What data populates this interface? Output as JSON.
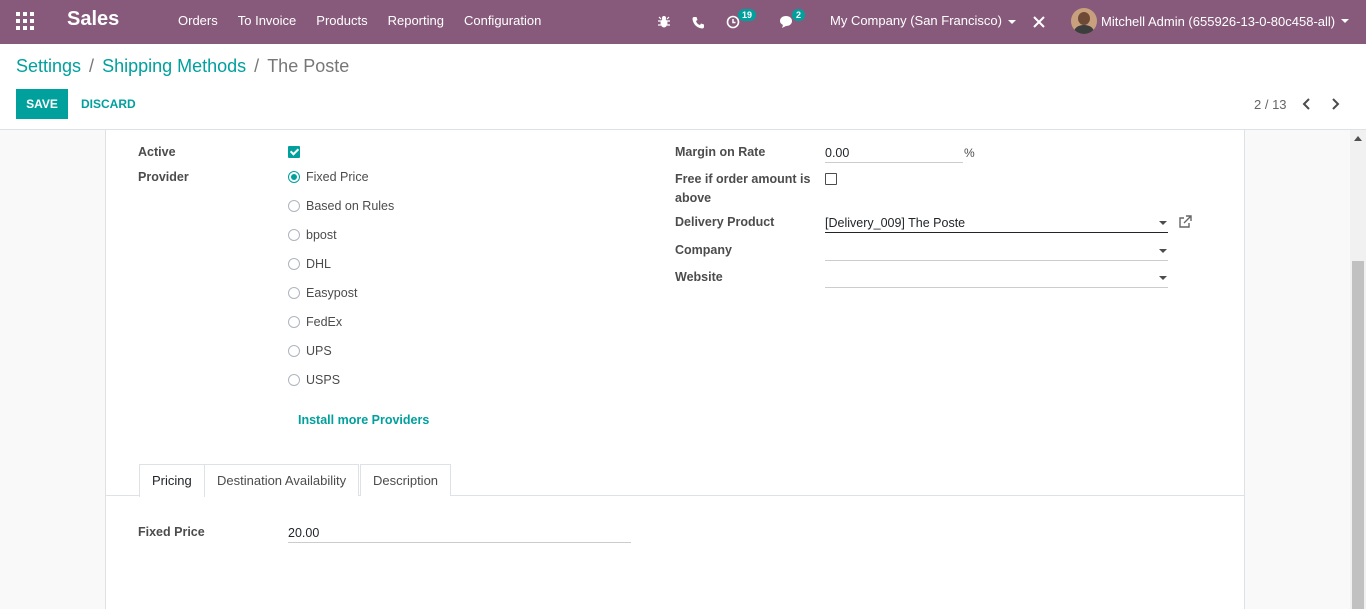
{
  "navbar": {
    "app_name": "Sales",
    "menu": [
      "Orders",
      "To Invoice",
      "Products",
      "Reporting",
      "Configuration"
    ],
    "activity_count": "19",
    "messages_count": "2",
    "company": "My Company (San Francisco)",
    "user": "Mitchell Admin (655926-13-0-80c458-all)",
    "icons": [
      "apps-grid-icon",
      "bug-icon",
      "phone-icon",
      "clock-icon",
      "chat-icon",
      "close-icon"
    ],
    "color": "#875a7b"
  },
  "breadcrumb": {
    "items": [
      "Settings",
      "Shipping Methods"
    ],
    "current": "The Poste",
    "separator": "/"
  },
  "buttons": {
    "save": "SAVE",
    "discard": "DISCARD"
  },
  "pager": {
    "text": "2 / 13"
  },
  "form": {
    "active_label": "Active",
    "active": true,
    "provider_label": "Provider",
    "providers": [
      "Fixed Price",
      "Based on Rules",
      "bpost",
      "DHL",
      "Easypost",
      "FedEx",
      "UPS",
      "USPS"
    ],
    "selected_provider": "Fixed Price",
    "install_more": "Install more Providers",
    "margin_label": "Margin on Rate",
    "margin_value": "0.00",
    "margin_unit": "%",
    "free_label_1": "Free if order amount is",
    "free_label_2": "above",
    "free_checked": false,
    "delivery_product_label": "Delivery Product",
    "delivery_product_value": "[Delivery_009] The Poste",
    "company_label": "Company",
    "company_value": "",
    "website_label": "Website",
    "website_value": ""
  },
  "tabs": [
    "Pricing",
    "Destination Availability",
    "Description"
  ],
  "active_tab": "Pricing",
  "pricing": {
    "fixed_price_label": "Fixed Price",
    "fixed_price_value": "20.00"
  },
  "accent_color": "#00a09d"
}
